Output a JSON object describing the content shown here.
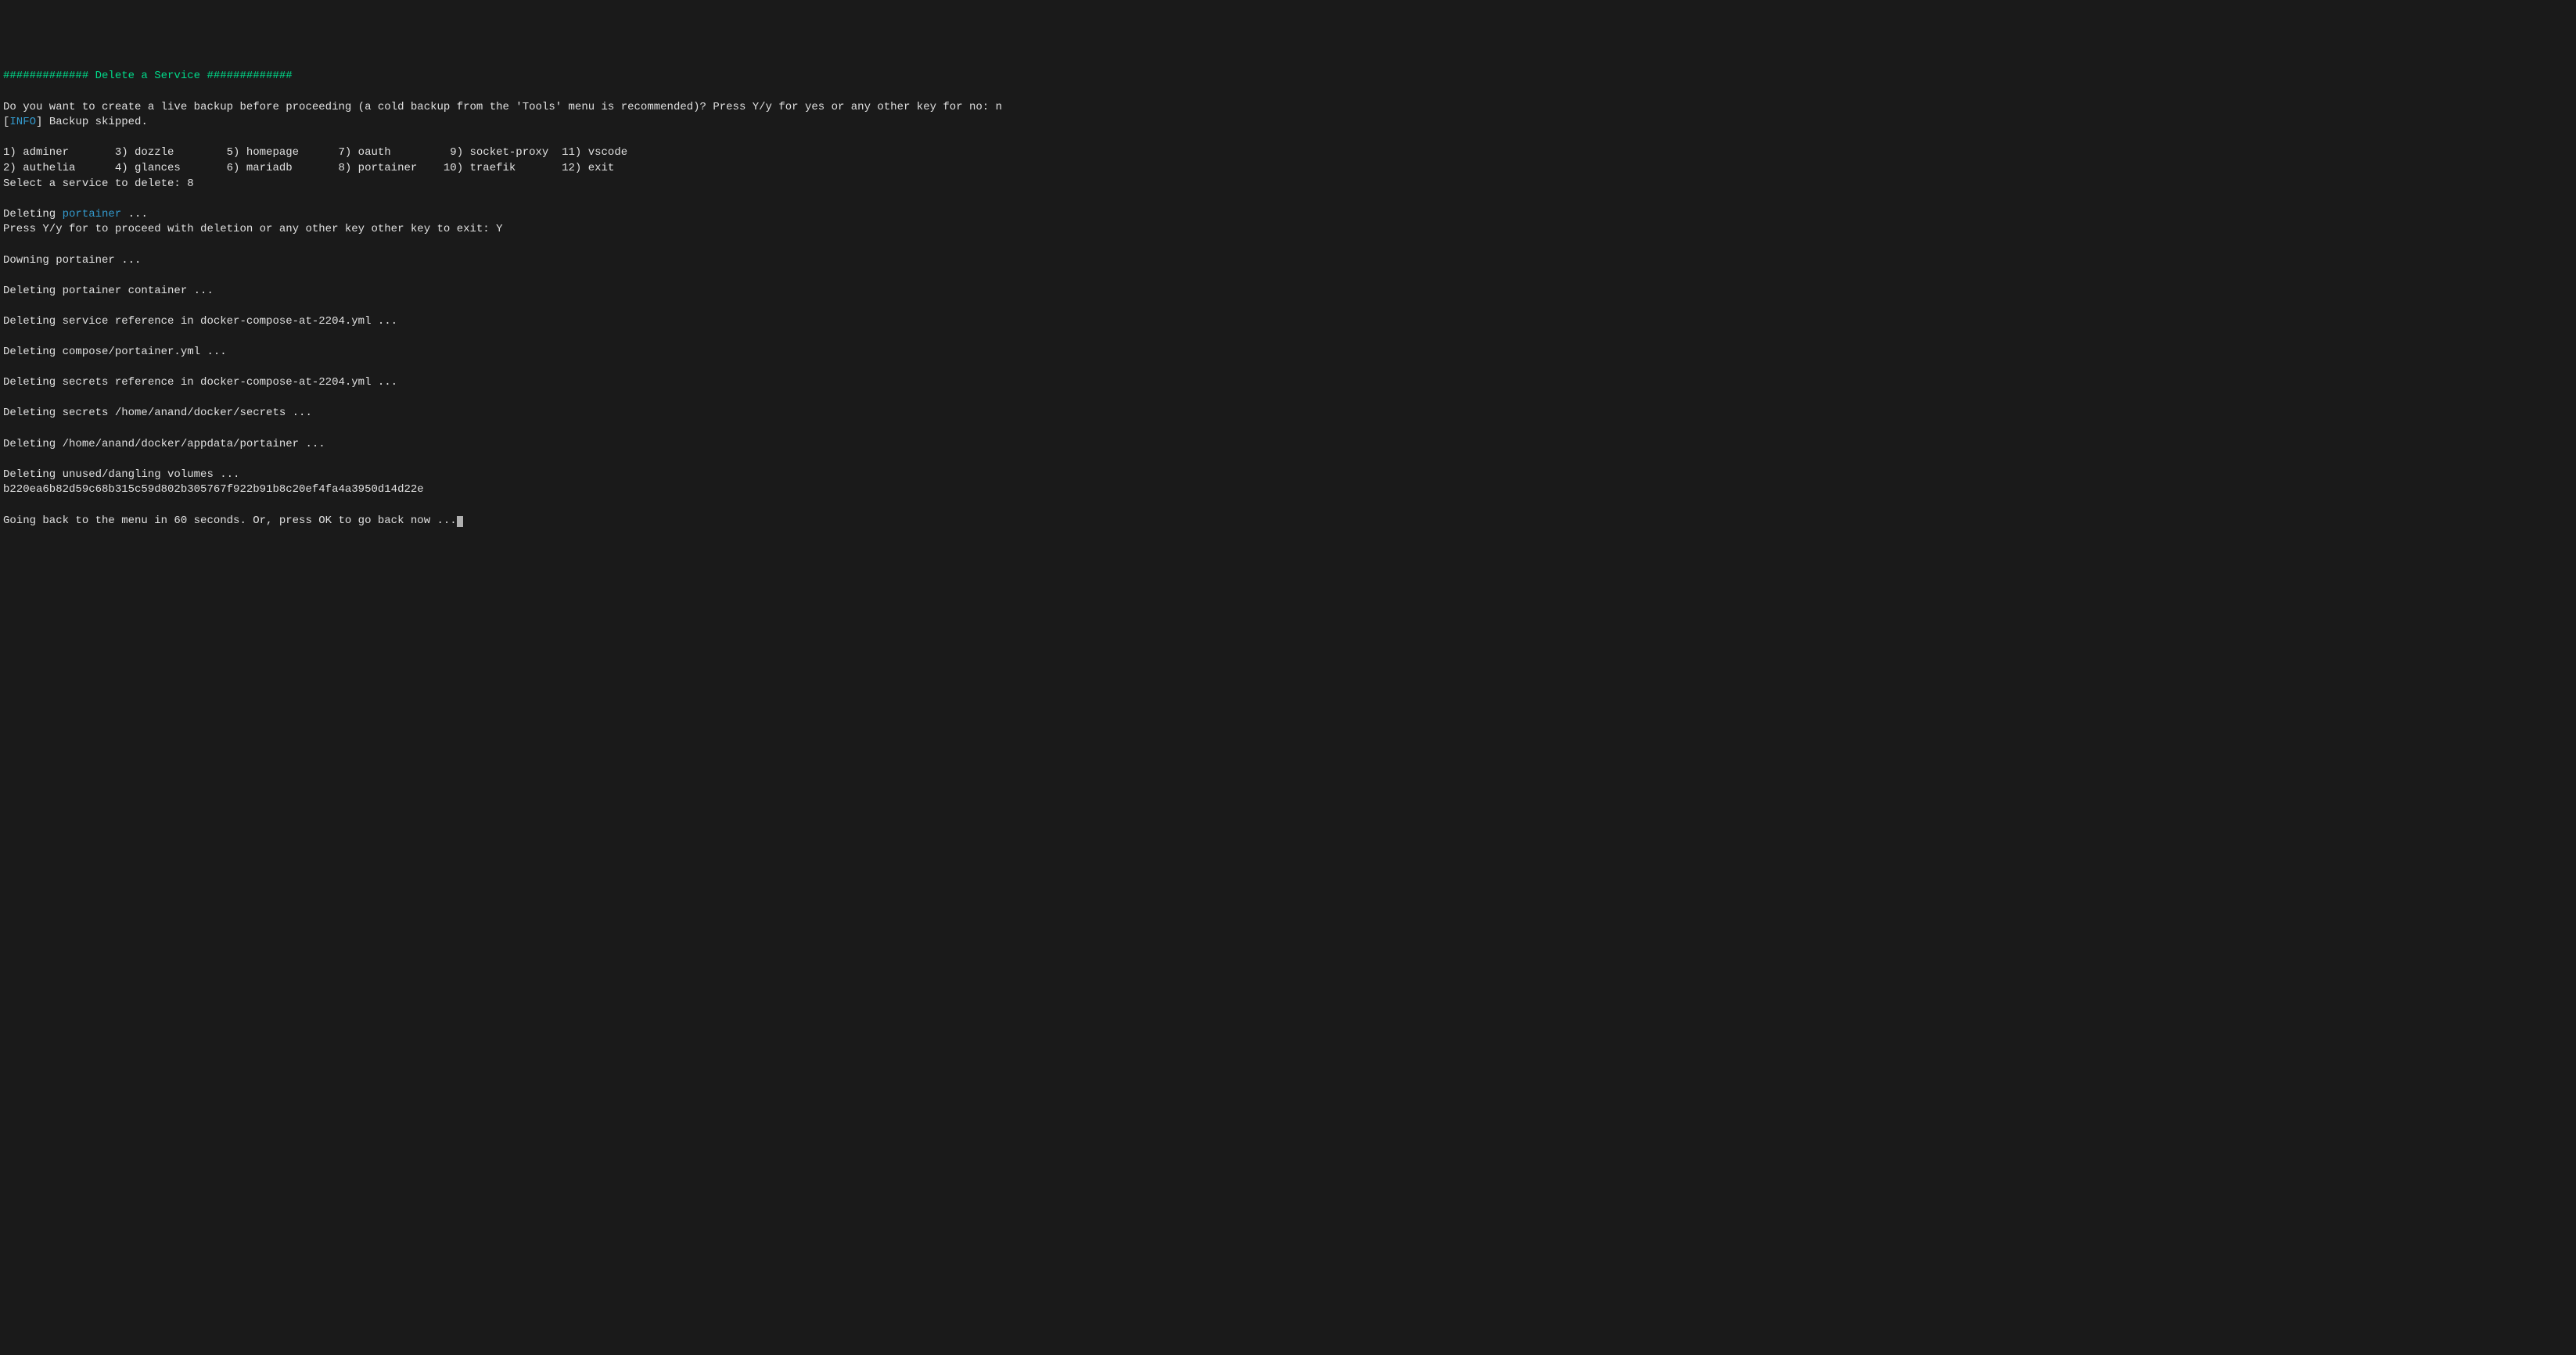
{
  "header": {
    "hash_left": "#############",
    "title": " Delete a Service ",
    "hash_right": "#############"
  },
  "backup": {
    "prompt": "Do you want to create a live backup before proceeding (a cold backup from the 'Tools' menu is recommended)? Press Y/y for yes or any other key for no: ",
    "response": "n",
    "info_label": "INFO",
    "skipped": " Backup skipped."
  },
  "services": {
    "row1": "1) adminer       3) dozzle        5) homepage      7) oauth         9) socket-proxy  11) vscode",
    "row2": "2) authelia      4) glances       6) mariadb       8) portainer    10) traefik       12) exit",
    "select_prompt": "Select a service to delete: ",
    "selection": "8"
  },
  "deleting": {
    "prefix": "Deleting ",
    "service_name": "portainer",
    "dots": " ...",
    "confirm_prompt": "Press Y/y for to proceed with deletion or any other key other key to exit: ",
    "confirm_response": "Y"
  },
  "progress": {
    "downing": "Downing portainer ...",
    "container": "Deleting portainer container ...",
    "service_ref": "Deleting service reference in docker-compose-at-2204.yml ...",
    "compose": "Deleting compose/portainer.yml ...",
    "secrets_ref": "Deleting secrets reference in docker-compose-at-2204.yml ...",
    "secrets_path": "Deleting secrets /home/anand/docker/secrets ...",
    "appdata": "Deleting /home/anand/docker/appdata/portainer ...",
    "volumes": "Deleting unused/dangling volumes ...",
    "volume_hash": "b220ea6b82d59c68b315c59d802b305767f922b91b8c20ef4fa4a3950d14d22e"
  },
  "footer": {
    "goback": "Going back to the menu in 60 seconds. Or, press OK to go back now ..."
  }
}
